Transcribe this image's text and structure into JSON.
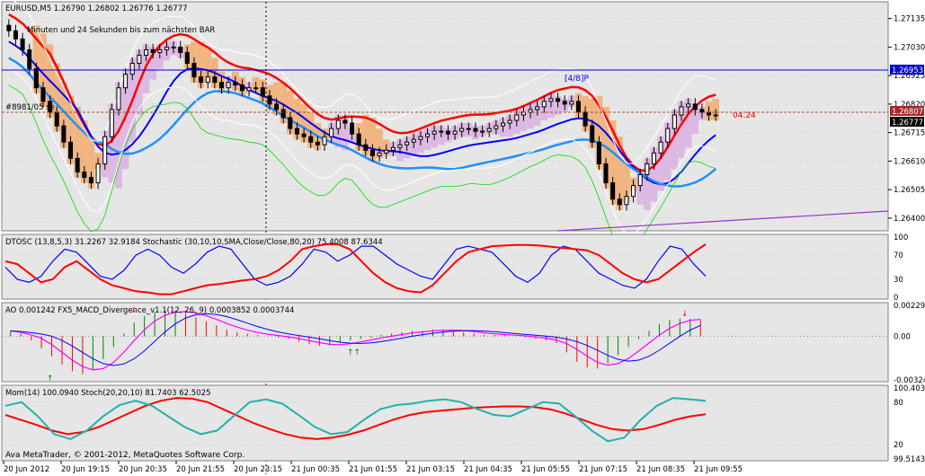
{
  "header": {
    "symbol_line": "EURUSD,M5  1.26790 1.26802 1.26776 1.26777",
    "countdown": "Minuten und 24 Sekunden bis zum nächsten BAR",
    "note_left": "#8981/05 se"
  },
  "colors": {
    "background": "#ffffff",
    "plot_bg": "#e6e6e6",
    "grid": "#c8c8c8",
    "bull": "#000000",
    "red": "#ff0000",
    "blue": "#0000ff",
    "cyan": "#1e90ff",
    "orange": "#f4a460",
    "violet": "#b070d0",
    "green": "#00dd00",
    "teal": "#20b2aa"
  },
  "chart_data": [
    {
      "type": "candlestick",
      "title": "EURUSD,M5  1.26790 1.26802 1.26776 1.26777",
      "ylim": [
        1.2636,
        1.2719
      ],
      "y_ticks": [
        "1.27135",
        "1.27030",
        "1.26925",
        "1.26820",
        "1.26715",
        "1.26610",
        "1.26505",
        "1.26400"
      ],
      "x_ticks": [
        "20 Jun 2012",
        "20 Jun 19:15",
        "20 Jun 20:35",
        "20 Jun 21:55",
        "20 Jun 23:15",
        "21 Jun 00:35",
        "21 Jun 01:55",
        "21 Jun 03:15",
        "21 Jun 04:35",
        "21 Jun 05:55",
        "21 Jun 07:15",
        "21 Jun 08:35",
        "21 Jun 09:55"
      ],
      "current_price": "1.26777",
      "tag_upper": "1.26807",
      "tag_level": "1.26953",
      "murrey_label": "[4/8]P",
      "level_label": "04.24",
      "levels": [
        1.26953,
        1.26807
      ],
      "close": [
        1.2709,
        1.2706,
        1.2702,
        1.2695,
        1.2688,
        1.2683,
        1.2679,
        1.2674,
        1.2668,
        1.2662,
        1.2657,
        1.2655,
        1.2653,
        1.266,
        1.267,
        1.268,
        1.2688,
        1.2693,
        1.2697,
        1.27,
        1.2702,
        1.2701,
        1.2702,
        1.2703,
        1.2703,
        1.2701,
        1.2697,
        1.2692,
        1.269,
        1.2692,
        1.269,
        1.2688,
        1.269,
        1.2689,
        1.2687,
        1.2688,
        1.2688,
        1.2685,
        1.2682,
        1.268,
        1.2677,
        1.2673,
        1.2671,
        1.267,
        1.2668,
        1.2667,
        1.267,
        1.2673,
        1.2676,
        1.2675,
        1.2671,
        1.2667,
        1.2665,
        1.2663,
        1.2664,
        1.2665,
        1.2666,
        1.2667,
        1.2668,
        1.2669,
        1.267,
        1.2671,
        1.2672,
        1.2672,
        1.2671,
        1.2672,
        1.2673,
        1.2673,
        1.2672,
        1.2672,
        1.2673,
        1.2674,
        1.2675,
        1.2676,
        1.2678,
        1.2679,
        1.268,
        1.2681,
        1.2683,
        1.2684,
        1.2683,
        1.2682,
        1.2683,
        1.2679,
        1.2674,
        1.2668,
        1.266,
        1.2653,
        1.2647,
        1.2645,
        1.2648,
        1.2652,
        1.2656,
        1.266,
        1.2664,
        1.2668,
        1.2673,
        1.2678,
        1.2681,
        1.2682,
        1.268,
        1.2679,
        1.2678,
        1.2678
      ]
    },
    {
      "type": "line",
      "title": "DTOSC (13,8,5,3) 31.2267 32.9184  Stochastic (30,10,10,SMA,Close/Close,80,20) 75.4008 87.6344",
      "y_ticks": [
        "100",
        "70",
        "30",
        "0"
      ],
      "ylim": [
        0,
        100
      ],
      "series": [
        {
          "name": "DTOSC",
          "values": [
            50,
            30,
            25,
            35,
            60,
            80,
            75,
            55,
            35,
            30,
            45,
            70,
            80,
            70,
            50,
            40,
            55,
            75,
            85,
            80,
            55,
            30,
            20,
            25,
            35,
            55,
            80,
            75,
            60,
            70,
            85,
            85,
            70,
            55,
            45,
            35,
            30,
            55,
            80,
            85,
            80,
            75,
            55,
            35,
            25,
            40,
            70,
            85,
            80,
            60,
            40,
            30,
            20,
            15,
            30,
            60,
            85,
            80,
            55,
            35
          ]
        },
        {
          "name": "Stochastic",
          "values": [
            60,
            55,
            40,
            25,
            30,
            50,
            60,
            45,
            30,
            20,
            15,
            10,
            8,
            5,
            5,
            10,
            15,
            20,
            22,
            25,
            28,
            30,
            35,
            45,
            60,
            80,
            85,
            88,
            88,
            80,
            60,
            40,
            25,
            15,
            10,
            8,
            20,
            40,
            60,
            75,
            80,
            85,
            86,
            87,
            87,
            86,
            84,
            82,
            80,
            78,
            70,
            55,
            40,
            30,
            25,
            30,
            45,
            60,
            75,
            88
          ]
        }
      ]
    },
    {
      "type": "bar",
      "title": "AO 0.001242  FX5_MACD_Divergence_v1.1(12, 26, 9) 0.0003852 0.0003744",
      "y_ticks": [
        "0.00229",
        "0.00",
        "-0.00324"
      ],
      "ylim": [
        -0.00324,
        0.00229
      ],
      "values": [
        0.0004,
        0.0002,
        -0.0003,
        -0.0009,
        -0.0015,
        -0.0021,
        -0.0026,
        -0.0028,
        -0.0025,
        -0.0017,
        -0.0008,
        0.0002,
        0.001,
        0.0015,
        0.0018,
        0.0019,
        0.0019,
        0.0017,
        0.0014,
        0.0011,
        0.0008,
        0.0005,
        0.0003,
        0.0002,
        0.0001,
        0.0,
        -0.0001,
        -0.0002,
        -0.0004,
        -0.0006,
        -0.0007,
        -0.0007,
        -0.0005,
        -0.0003,
        -0.0002,
        -0.0001,
        0.0001,
        0.0002,
        0.0003,
        0.0004,
        0.0004,
        0.0005,
        0.0005,
        0.0004,
        0.0003,
        0.0002,
        0.0001,
        0.0001,
        0.0001,
        0.0,
        -0.0001,
        -0.0002,
        -0.0003,
        -0.0005,
        -0.0012,
        -0.0019,
        -0.0023,
        -0.0024,
        -0.002,
        -0.0014,
        -0.0008,
        -0.0002,
        0.0004,
        0.0009,
        0.0012,
        0.0013,
        0.0013,
        0.0012
      ]
    },
    {
      "type": "line",
      "title": "Mom(14) 100.0940  Stoch(20,20,10) 81.7403 62.5025",
      "y_ticks": [
        "100.4035",
        "80",
        "20",
        "99.5143"
      ],
      "series": [
        {
          "name": "Stoch",
          "values": [
            62,
            55,
            48,
            40,
            35,
            38,
            45,
            55,
            65,
            75,
            82,
            86,
            85,
            80,
            70,
            60,
            50,
            42,
            35,
            30,
            28,
            30,
            34,
            40,
            48,
            56,
            62,
            66,
            68,
            70,
            72,
            73,
            74,
            74,
            73,
            70,
            64,
            56,
            48,
            42,
            40,
            42,
            48,
            55,
            60,
            63
          ]
        },
        {
          "name": "Mom",
          "values": [
            75,
            80,
            60,
            35,
            28,
            40,
            60,
            76,
            82,
            75,
            60,
            45,
            35,
            40,
            60,
            80,
            84,
            78,
            62,
            45,
            35,
            38,
            55,
            70,
            76,
            78,
            82,
            84,
            80,
            70,
            62,
            60,
            70,
            80,
            78,
            60,
            40,
            25,
            30,
            55,
            75,
            86,
            84,
            82
          ]
        }
      ]
    }
  ],
  "copyright": "Ava MetaTrader, © 2001-2012, MetaQuotes Software Corp."
}
